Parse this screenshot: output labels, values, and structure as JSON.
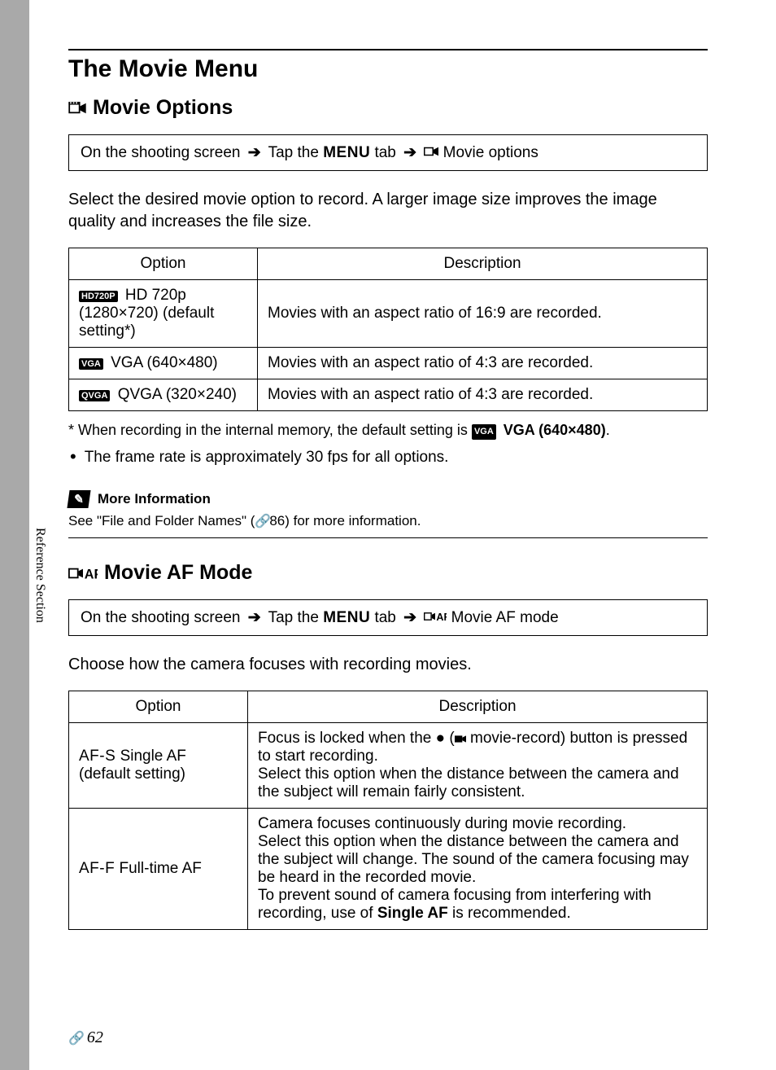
{
  "page_title": "The Movie Menu",
  "side_label": "Reference Section",
  "page_number": "62",
  "sections": {
    "movie_options": {
      "heading": "Movie Options",
      "nav_prefix": "On the shooting screen",
      "nav_mid": "Tap the",
      "nav_menu": "MENU",
      "nav_tab": "tab",
      "nav_end": "Movie options",
      "intro": "Select the desired movie option to record. A larger image size improves the image quality and increases the file size.",
      "table_headers": {
        "option": "Option",
        "description": "Description"
      },
      "rows": [
        {
          "badge": "HD720P",
          "label": "HD 720p (1280×720) (default setting*)",
          "desc": "Movies with an aspect ratio of 16:9 are recorded."
        },
        {
          "badge": "VGA",
          "label": "VGA (640×480)",
          "desc": "Movies with an aspect ratio of 4:3 are recorded."
        },
        {
          "badge": "QVGA",
          "label": "QVGA (320×240)",
          "desc": "Movies with an aspect ratio of 4:3 are recorded."
        }
      ],
      "footnote_prefix": "*   When recording in the internal memory, the default setting is",
      "footnote_badge": "VGA",
      "footnote_bold": "VGA (640×480)",
      "footnote_suffix": ".",
      "bullet": "The frame rate is approximately 30 fps for all options.",
      "info_heading": "More Information",
      "info_body_prefix": "See \"File and Folder Names\" (",
      "info_body_page": "86",
      "info_body_suffix": ") for more information."
    },
    "movie_af": {
      "heading": "Movie AF Mode",
      "nav_prefix": "On the shooting screen",
      "nav_mid": "Tap the",
      "nav_menu": "MENU",
      "nav_tab": "tab",
      "nav_end": "Movie AF mode",
      "intro": "Choose how the camera focuses with recording movies.",
      "table_headers": {
        "option": "Option",
        "description": "Description"
      },
      "rows": [
        {
          "af_label": "AF-S",
          "label": "Single AF (default setting)",
          "desc_pre": "Focus is locked when the",
          "desc_mid": "movie-record) button is pressed to start recording.",
          "desc_post": "Select this option when the distance between the camera and the subject will remain fairly consistent."
        },
        {
          "af_label": "AF-F",
          "label": "Full-time AF",
          "desc1": "Camera focuses continuously during movie recording.",
          "desc2": "Select this option when the distance between the camera and the subject will change. The sound of the camera focusing may be heard in the recorded movie.",
          "desc3_pre": "To prevent sound of camera focusing from interfering with recording, use of",
          "desc3_bold": "Single AF",
          "desc3_post": "is recommended."
        }
      ]
    }
  }
}
